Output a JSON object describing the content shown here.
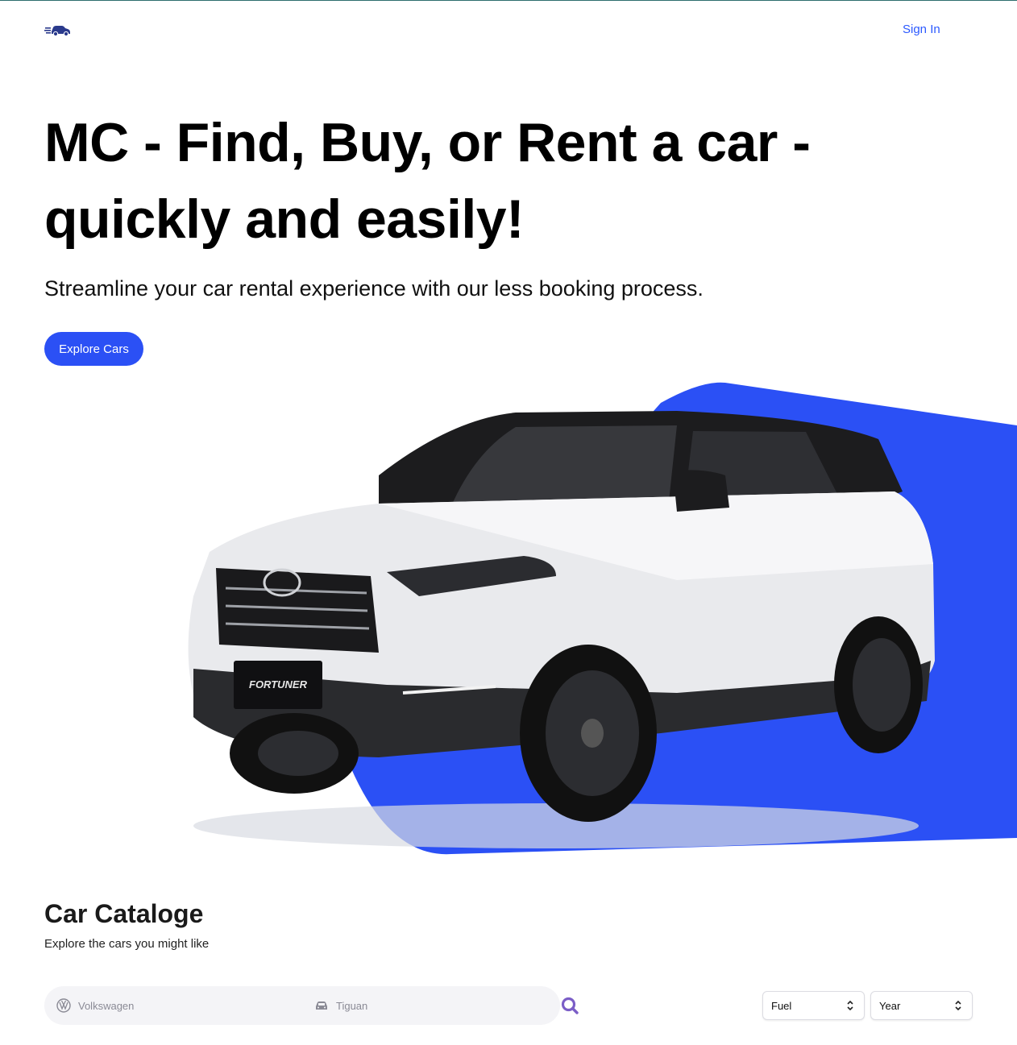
{
  "header": {
    "logo_icon": "car-logo-icon",
    "sign_in_label": "Sign In"
  },
  "hero": {
    "title": "MC - Find, Buy, or Rent a car - quickly and easily!",
    "subtitle": "Streamline your car rental experience with our less booking process.",
    "cta_label": "Explore Cars",
    "image_subject": "white-suv",
    "accent_color": "#2b50f5"
  },
  "catalog": {
    "title": "Car Cataloge",
    "subtitle": "Explore the cars you might like",
    "search": {
      "make_placeholder": "Volkswagen",
      "make_icon": "volkswagen-logo-icon",
      "model_placeholder": "Tiguan",
      "model_icon": "car-icon",
      "search_icon": "magnifier-icon",
      "search_icon_color": "#7b5ec7"
    },
    "filters": {
      "fuel_label": "Fuel",
      "year_label": "Year"
    }
  },
  "colors": {
    "brand": "#2b50f5",
    "link": "#2b59ff",
    "search_bg": "#f4f4f7"
  }
}
